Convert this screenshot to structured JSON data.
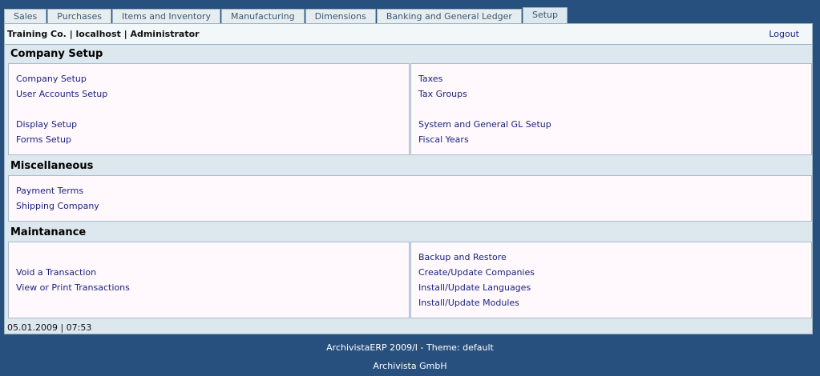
{
  "tabs": [
    "Sales",
    "Purchases",
    "Items and Inventory",
    "Manufacturing",
    "Dimensions",
    "Banking and General Ledger",
    "Setup"
  ],
  "active_tab": "Setup",
  "header": {
    "user_info": "Training Co. | localhost | Administrator",
    "logout": "Logout"
  },
  "sections": {
    "company_setup": {
      "title": "Company Setup",
      "left": [
        "Company Setup",
        "User Accounts Setup",
        "Display Setup",
        "Forms Setup"
      ],
      "right": [
        "Taxes",
        "Tax Groups",
        "System and General GL Setup",
        "Fiscal Years"
      ]
    },
    "miscellaneous": {
      "title": "Miscellaneous",
      "left": [
        "Payment Terms",
        "Shipping Company"
      ]
    },
    "maintanance": {
      "title": "Maintanance",
      "left": [
        "Void a Transaction",
        "View or Print Transactions"
      ],
      "right": [
        "Backup and Restore",
        "Create/Update Companies",
        "Install/Update Languages",
        "Install/Update Modules"
      ]
    }
  },
  "status": {
    "datetime": "05.01.2009 | 07:53"
  },
  "footer": {
    "line1": "ArchivistaERP 2009/I - Theme: default",
    "line2": "Archivista GmbH"
  },
  "colors": {
    "background": "#28507e",
    "panel": "#fff8fd",
    "link": "#1a237e"
  }
}
